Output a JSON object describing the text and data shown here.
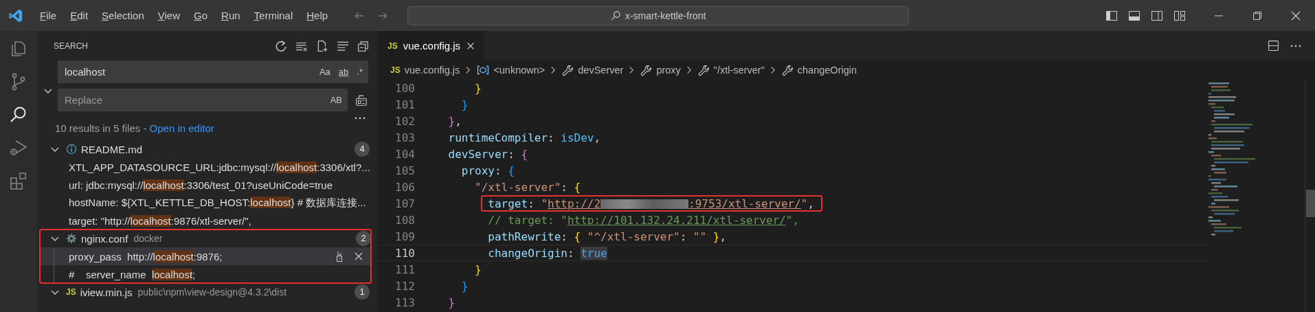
{
  "title_bar": {
    "menu": [
      "File",
      "Edit",
      "Selection",
      "View",
      "Go",
      "Run",
      "Terminal",
      "Help"
    ],
    "command_center": "x-smart-kettle-front"
  },
  "activity_bar": [
    {
      "kind": "explorer",
      "selected": false
    },
    {
      "kind": "source-control",
      "selected": false
    },
    {
      "kind": "search",
      "selected": true
    },
    {
      "kind": "run-debug",
      "selected": false
    },
    {
      "kind": "extensions",
      "selected": false
    }
  ],
  "sidebar": {
    "title": "SEARCH",
    "replace_expanded": true,
    "search": {
      "value": "localhost",
      "toggles": [
        "Aa",
        "ab",
        ".*"
      ]
    },
    "replace": {
      "placeholder": "Replace",
      "toggle": "AB"
    },
    "summary": "10 results in 5 files - ",
    "summary_link": "Open in editor",
    "files": [
      {
        "kind": "info",
        "name": "README.md",
        "count": "4",
        "expanded": true,
        "annotated": false,
        "matches": [
          {
            "before": "XTL_APP_DATASOURCE_URL:jdbc:mysql://",
            "match": "localhost",
            "after": ":3306/xtl?...",
            "selected": false
          },
          {
            "before": "url: jdbc:mysql://",
            "match": "localhost",
            "after": ":3306/test_01?useUniCode=true",
            "selected": false
          },
          {
            "before": "hostName: ${XTL_KETTLE_DB_HOST:",
            "match": "localhost",
            "after": "} # 数据库连接...",
            "selected": false
          },
          {
            "before": "target: \"http://",
            "match": "localhost",
            "after": ":9876/xtl-server/\",",
            "selected": false
          }
        ]
      },
      {
        "kind": "config",
        "name": "nginx.conf",
        "path": "docker",
        "count": "2",
        "expanded": true,
        "annotated": true,
        "matches": [
          {
            "before": "proxy_pass  http://",
            "match": "localhost",
            "after": ":9876;",
            "selected": true
          },
          {
            "before": "#    server_name  ",
            "match": "localhost",
            "after": ";",
            "selected": false
          }
        ]
      },
      {
        "kind": "js",
        "badge": "JS",
        "name": "iview.min.js",
        "path": "public\\npm\\view-design@4.3.2\\dist",
        "count": "1",
        "expanded": true,
        "annotated": false
      }
    ]
  },
  "editor": {
    "tab": {
      "badge": "JS",
      "label": "vue.config.js",
      "selected": true
    },
    "breadcrumbs": [
      {
        "kind": "js",
        "badge": "JS",
        "label": "vue.config.js"
      },
      {
        "kind": "symbol",
        "label": "<unknown>"
      },
      {
        "kind": "property",
        "label": "devServer"
      },
      {
        "kind": "property",
        "label": "proxy"
      },
      {
        "kind": "property",
        "label": "\"/xtl-server\""
      },
      {
        "kind": "property",
        "label": "changeOrigin"
      }
    ],
    "lines": [
      {
        "number": "100",
        "current": false,
        "annotated": false,
        "tokens": [
          {
            "text": "        }",
            "kind": "brace-yellow"
          }
        ]
      },
      {
        "number": "101",
        "current": false,
        "annotated": false,
        "tokens": [
          {
            "text": "      }",
            "kind": "brace-blue"
          }
        ]
      },
      {
        "number": "102",
        "current": false,
        "annotated": false,
        "tokens": [
          {
            "text": "    }",
            "kind": "brace-pink"
          },
          {
            "text": ",",
            "kind": "plain"
          }
        ]
      },
      {
        "number": "103",
        "current": false,
        "annotated": false,
        "tokens": [
          {
            "text": "    runtimeCompiler",
            "kind": "key"
          },
          {
            "text": ": ",
            "kind": "plain"
          },
          {
            "text": "isDev",
            "kind": "variable"
          },
          {
            "text": ",",
            "kind": "plain"
          }
        ]
      },
      {
        "number": "104",
        "current": false,
        "annotated": false,
        "tokens": [
          {
            "text": "    devServer",
            "kind": "key"
          },
          {
            "text": ": ",
            "kind": "plain"
          },
          {
            "text": "{",
            "kind": "brace-pink"
          }
        ]
      },
      {
        "number": "105",
        "current": false,
        "annotated": false,
        "tokens": [
          {
            "text": "      proxy",
            "kind": "key"
          },
          {
            "text": ": ",
            "kind": "plain"
          },
          {
            "text": "{",
            "kind": "brace-blue"
          }
        ]
      },
      {
        "number": "106",
        "current": false,
        "annotated": false,
        "tokens": [
          {
            "text": "        \"/xtl-server\"",
            "kind": "string"
          },
          {
            "text": ": ",
            "kind": "plain"
          },
          {
            "text": "{",
            "kind": "brace-yellow"
          }
        ]
      },
      {
        "number": "107",
        "current": false,
        "annotated": true,
        "tokens": [
          {
            "text": "          target",
            "kind": "key"
          },
          {
            "text": ": ",
            "kind": "plain"
          },
          {
            "text": "\"",
            "kind": "string"
          },
          {
            "text": "http://2",
            "kind": "link"
          },
          {
            "kind": "redacted"
          },
          {
            "text": ":9753/xtl-server/",
            "kind": "link"
          },
          {
            "text": "\"",
            "kind": "string"
          },
          {
            "text": ",",
            "kind": "plain"
          }
        ]
      },
      {
        "number": "108",
        "current": false,
        "annotated": false,
        "tokens": [
          {
            "text": "          // target: \"",
            "kind": "comment"
          },
          {
            "text": "http://101.132.24.211/xtl-server/",
            "kind": "comment-link"
          },
          {
            "text": "\",",
            "kind": "comment"
          }
        ]
      },
      {
        "number": "109",
        "current": false,
        "annotated": false,
        "tokens": [
          {
            "text": "          pathRewrite",
            "kind": "key"
          },
          {
            "text": ": ",
            "kind": "plain"
          },
          {
            "text": "{",
            "kind": "brace-yellow"
          },
          {
            "text": " \"^/xtl-server\"",
            "kind": "string"
          },
          {
            "text": ": ",
            "kind": "plain"
          },
          {
            "text": "\"\"",
            "kind": "string"
          },
          {
            "text": " }",
            "kind": "brace-yellow"
          },
          {
            "text": ",",
            "kind": "plain"
          }
        ]
      },
      {
        "number": "110",
        "current": true,
        "annotated": false,
        "tokens": [
          {
            "text": "          changeOrigin",
            "kind": "key"
          },
          {
            "text": ": ",
            "kind": "plain"
          },
          {
            "text": "true",
            "kind": "keyword-selected"
          }
        ]
      },
      {
        "number": "111",
        "current": false,
        "annotated": false,
        "tokens": [
          {
            "text": "        }",
            "kind": "brace-yellow"
          }
        ]
      },
      {
        "number": "112",
        "current": false,
        "annotated": false,
        "tokens": [
          {
            "text": "      }",
            "kind": "brace-blue"
          }
        ]
      },
      {
        "number": "113",
        "current": false,
        "annotated": false,
        "tokens": [
          {
            "text": "    }",
            "kind": "brace-pink"
          }
        ]
      }
    ]
  }
}
